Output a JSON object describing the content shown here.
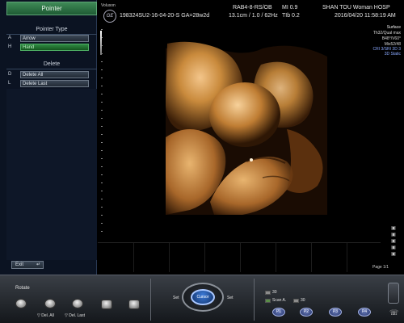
{
  "panel": {
    "header": "Pointer",
    "pointer_type_title": "Pointer Type",
    "pointer_options": [
      {
        "key": "A",
        "label": "Arrow",
        "selected": false
      },
      {
        "key": "H",
        "label": "Hand",
        "selected": true
      }
    ],
    "delete_title": "Delete",
    "delete_options": [
      {
        "key": "D",
        "label": "Delete All"
      },
      {
        "key": "L",
        "label": "Delete Last"
      }
    ],
    "exit_label": "Exit",
    "exit_arrow": "↵"
  },
  "header": {
    "brand": "Voluson",
    "logo_text": "GE",
    "exam_id": "198324SU2-16-04-20-S GA=28w2d",
    "probe": "RAB4-8-RS/OB",
    "mi": "MI 0.9",
    "hospital": "SHAN TOU Woman HOSP",
    "depth": "13.1cm / 1.0 / 62Hz",
    "tib": "TIb 0.2",
    "datetime": "2016/04/20  11:58:19 AM"
  },
  "info": {
    "mode": "Surface",
    "quality": "Th32/Qual max",
    "angle": "B48°/V60°",
    "mix": "Mix52/48",
    "cri": "CRI 3/SRI 3D 3",
    "static": "3D Static"
  },
  "cine": {
    "page_label": "Page 1/1"
  },
  "console": {
    "rotate_label": "Rotate",
    "del_all_label": "▽ Del. All",
    "del_last_label": "▽ Del. Last",
    "set_left": "Set",
    "set_right": "Set",
    "cursor_label": "Cursor",
    "key_30a": "30",
    "scan_label": "Scan A.",
    "key_30b": "30",
    "fkeys": [
      "P1",
      "P2",
      "P3",
      "P4"
    ],
    "phone_icon": "☏"
  },
  "colors": {
    "panel_bg": "#0b1322",
    "selected_green": "#2f8a43",
    "render_tone": "#c98a3c",
    "accent_blue": "#8aa9ff"
  }
}
